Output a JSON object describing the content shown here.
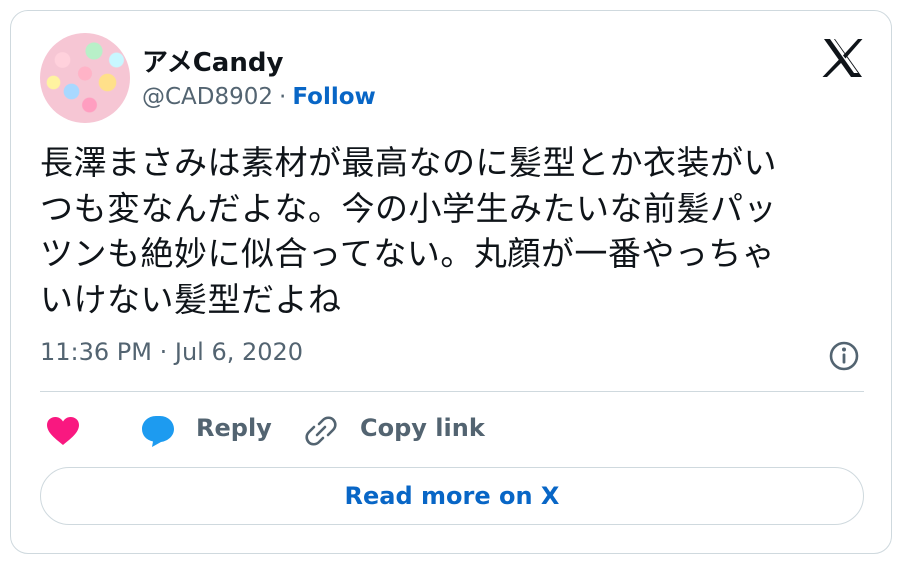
{
  "user": {
    "display_name": "アメCandy",
    "handle": "@CAD8902",
    "separator": "·",
    "follow_label": "Follow"
  },
  "tweet": {
    "text_lines": [
      "長澤まさみは素材が最高なのに髪型とか衣装がい",
      "つも変なんだよな。今の小学生みたいな前髪パッ",
      "ツンも絶妙に似合ってない。丸顔が一番やっちゃ",
      "いけない髪型だよね"
    ],
    "timestamp": "11:36 PM · Jul 6, 2020"
  },
  "actions": {
    "reply_label": "Reply",
    "copy_link_label": "Copy link",
    "read_more_label": "Read more on X"
  },
  "icons": {
    "logo": "x-logo-icon",
    "info": "info-icon",
    "like": "heart-icon",
    "reply": "speech-bubble-icon",
    "copy": "link-icon"
  },
  "colors": {
    "link_blue": "#0866c6",
    "heart_pink": "#f91880",
    "reply_blue": "#1d9bf0",
    "text_primary": "#0f1419",
    "text_secondary": "#536471",
    "border": "#cfd9de"
  }
}
